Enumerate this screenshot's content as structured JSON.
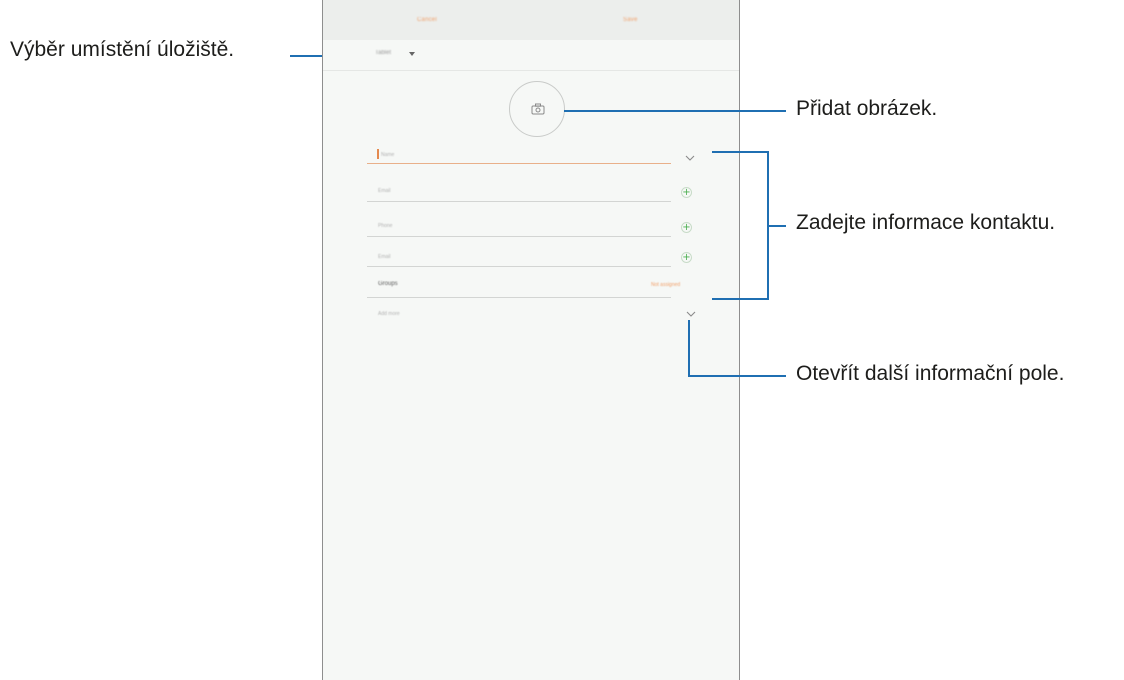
{
  "callouts": {
    "storage": "Výběr umístění úložiště.",
    "picture": "Přidat obrázek.",
    "info": "Zadejte informace kontaktu.",
    "more": "Otevřít další informační pole."
  },
  "toolbar": {
    "cancel_label": "Cancel",
    "save_label": "Save"
  },
  "storage_selector": {
    "value": "Tablet"
  },
  "fields": [
    {
      "placeholder": "Name"
    },
    {
      "placeholder": "Email"
    },
    {
      "placeholder": "Phone"
    },
    {
      "placeholder": "Email"
    }
  ],
  "groups": {
    "label": "Groups",
    "value": "Not assigned"
  },
  "more_fields": {
    "label": "Add more"
  },
  "colors": {
    "accent": "#f1a06a",
    "callout_line": "#1f6fb2",
    "plus": "#4caf50"
  },
  "icons": [
    "camera-icon",
    "chevron-down-icon",
    "plus-icon",
    "caret-down-icon"
  ]
}
